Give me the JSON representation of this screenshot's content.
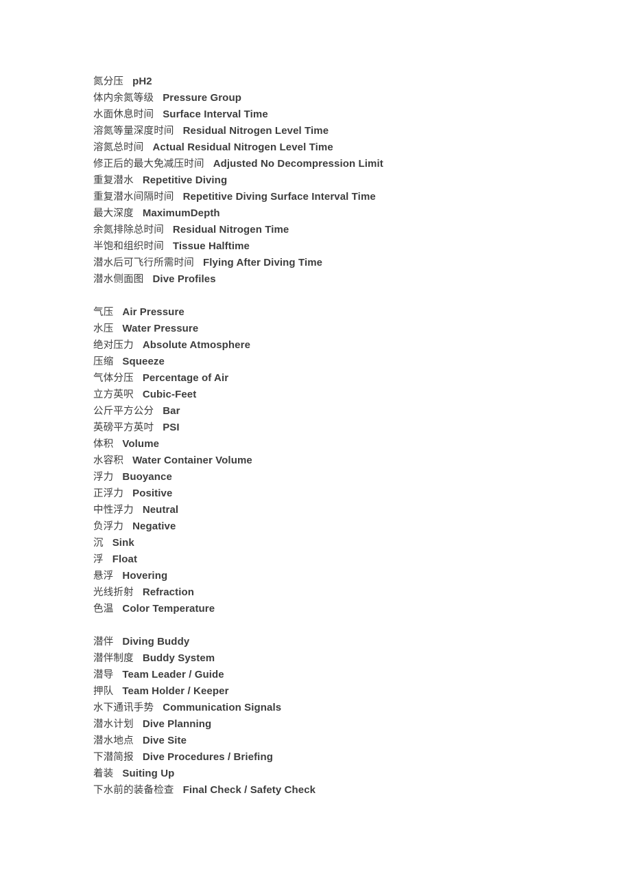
{
  "document": {
    "text_color": "#3d3d3d",
    "background_color": "#ffffff",
    "sections": [
      {
        "id": "nitrogen-and-dive-tables",
        "entries": [
          {
            "zh": "氮分压",
            "en": "pH2"
          },
          {
            "zh": "体内余氮等级",
            "en": "Pressure Group"
          },
          {
            "zh": "水面休息时间",
            "en": "Surface Interval Time"
          },
          {
            "zh": "溶氮等量深度时间",
            "en": "Residual Nitrogen Level Time"
          },
          {
            "zh": "溶氮总时间",
            "en": "Actual Residual Nitrogen Level Time"
          },
          {
            "zh": "修正后的最大免减压时间",
            "en": "Adjusted No Decompression Limit"
          },
          {
            "zh": "重复潜水",
            "en": "Repetitive Diving"
          },
          {
            "zh": "重复潜水间隔时间",
            "en": "Repetitive Diving Surface Interval Time"
          },
          {
            "zh": "最大深度",
            "en": "MaximumDepth"
          },
          {
            "zh": "余氮排除总时间",
            "en": "Residual Nitrogen Time"
          },
          {
            "zh": "半饱和组织时间",
            "en": "Tissue Halftime"
          },
          {
            "zh": "潜水后可飞行所需时间",
            "en": "Flying After Diving Time"
          },
          {
            "zh": "潜水侧面图",
            "en": "Dive Profiles"
          }
        ]
      },
      {
        "id": "pressure-and-buoyancy",
        "entries": [
          {
            "zh": "气压",
            "en": "Air Pressure"
          },
          {
            "zh": "水压",
            "en": "Water Pressure"
          },
          {
            "zh": "绝对压力",
            "en": "Absolute Atmosphere"
          },
          {
            "zh": "压缩",
            "en": "Squeeze"
          },
          {
            "zh": "气体分压",
            "en": "Percentage of Air"
          },
          {
            "zh": "立方英呎",
            "en": "Cubic-Feet"
          },
          {
            "zh": "公斤平方公分",
            "en": "Bar"
          },
          {
            "zh": "英磅平方英吋",
            "en": "PSI"
          },
          {
            "zh": "体积",
            "en": "Volume"
          },
          {
            "zh": "水容积",
            "en": "Water Container Volume"
          },
          {
            "zh": "浮力",
            "en": "Buoyance"
          },
          {
            "zh": "正浮力",
            "en": "Positive"
          },
          {
            "zh": "中性浮力",
            "en": "Neutral"
          },
          {
            "zh": "负浮力",
            "en": "Negative"
          },
          {
            "zh": "沉",
            "en": "Sink"
          },
          {
            "zh": "浮",
            "en": "Float"
          },
          {
            "zh": "悬浮",
            "en": "Hovering"
          },
          {
            "zh": "光线折射",
            "en": "Refraction"
          },
          {
            "zh": "色温",
            "en": "Color Temperature"
          }
        ]
      },
      {
        "id": "buddy-and-dive-planning",
        "entries": [
          {
            "zh": "潜伴",
            "en": "Diving Buddy"
          },
          {
            "zh": "潜伴制度",
            "en": "Buddy System"
          },
          {
            "zh": "潜导",
            "en": "Team Leader / Guide"
          },
          {
            "zh": "押队",
            "en": "Team Holder / Keeper"
          },
          {
            "zh": "水下通讯手势",
            "en": "Communication Signals"
          },
          {
            "zh": "潜水计划",
            "en": "Dive Planning"
          },
          {
            "zh": "潜水地点",
            "en": "Dive Site"
          },
          {
            "zh": "下潜简报",
            "en": "Dive Procedures / Briefing"
          },
          {
            "zh": "着装",
            "en": "Suiting Up"
          },
          {
            "zh": "下水前的装备检查",
            "en": "Final Check / Safety Check"
          }
        ]
      }
    ]
  }
}
